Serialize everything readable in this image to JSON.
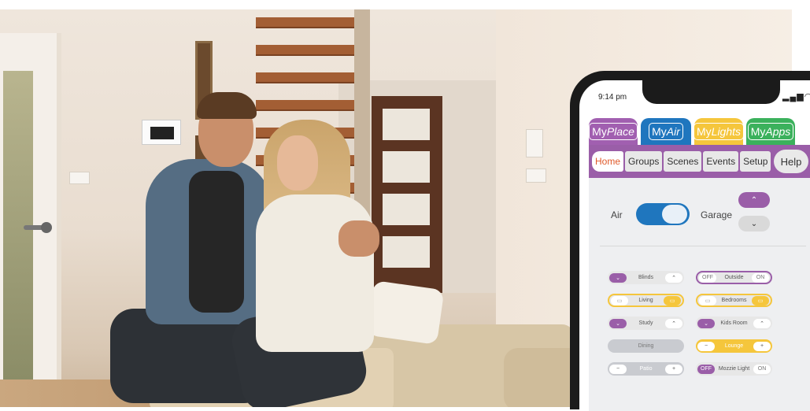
{
  "status": {
    "time": "9:14 pm",
    "icons": "signal wifi battery"
  },
  "apps": [
    {
      "my": "My",
      "name": "Place"
    },
    {
      "my": "My",
      "name": "Air"
    },
    {
      "my": "My",
      "name": "Lights"
    },
    {
      "my": "My",
      "name": "Apps"
    }
  ],
  "nav": {
    "home": "Home",
    "groups": "Groups",
    "scenes": "Scenes",
    "events": "Events",
    "setup": "Setup",
    "help": "Help"
  },
  "controls": {
    "air_label": "Air",
    "garage_label": "Garage",
    "up_glyph": "⌃",
    "down_glyph": "⌄"
  },
  "tiles": {
    "blinds": "Blinds",
    "outside": "Outside",
    "outside_off": "OFF",
    "outside_on": "ON",
    "living": "Living",
    "bedrooms": "Bedrooms",
    "study": "Study",
    "kids": "Kids Room",
    "dining": "Dining",
    "lounge": "Lounge",
    "patio": "Patio",
    "mozzie": "Mozzie Light",
    "mozzie_off": "OFF",
    "mozzie_on": "ON",
    "minus": "−",
    "plus": "+"
  },
  "colors": {
    "purple": "#9a5ea8",
    "blue": "#1f76be",
    "yellow": "#f5c63c",
    "green": "#3bb15c"
  }
}
